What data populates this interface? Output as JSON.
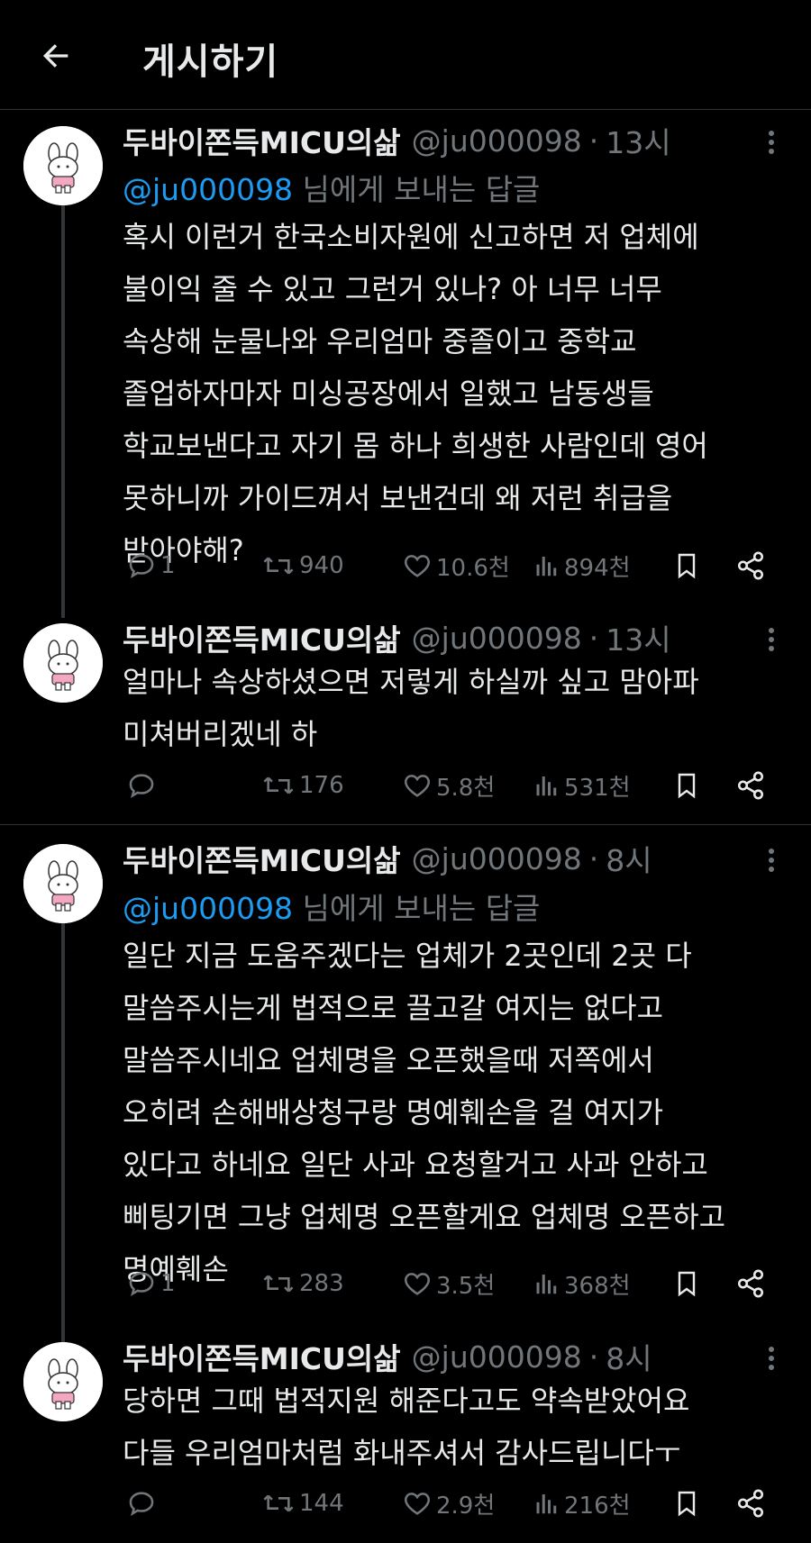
{
  "header": {
    "title": "게시하기",
    "back_icon": "arrow-left-icon"
  },
  "tweets": [
    {
      "name": "두바이쫀득MICU의삶",
      "handle": "@ju000098",
      "dot": "·",
      "time": "13시",
      "reply_mention": "@ju000098",
      "reply_suffix": " 님에게 보내는 답글",
      "text": "혹시 이런거 한국소비자원에 신고하면 저 업체에\n불이익 줄 수 있고 그런거 있나? 아 너무 너무\n속상해 눈물나와 우리엄마 중졸이고 중학교\n졸업하자마자 미싱공장에서 일했고 남동생들\n학교보낸다고 자기 몸 하나 희생한 사람인데 영어\n못하니까 가이드껴서 보낸건데 왜 저런 취급을\n받아야해?",
      "stats": {
        "replies": "1",
        "retweets": "940",
        "likes": "10.6천",
        "views": "894천"
      }
    },
    {
      "name": "두바이쫀득MICU의삶",
      "handle": "@ju000098",
      "dot": "·",
      "time": "13시",
      "text": "얼마나 속상하셨으면 저렇게 하실까 싶고 맘아파\n미쳐버리겠네 하",
      "stats": {
        "replies": "",
        "retweets": "176",
        "likes": "5.8천",
        "views": "531천"
      }
    },
    {
      "name": "두바이쫀득MICU의삶",
      "handle": "@ju000098",
      "dot": "·",
      "time": "8시",
      "reply_mention": "@ju000098",
      "reply_suffix": " 님에게 보내는 답글",
      "text": "일단 지금 도움주겠다는 업체가 2곳인데 2곳 다\n말씀주시는게 법적으로 끌고갈 여지는 없다고\n말씀주시네요 업체명을 오픈했을때 저쪽에서\n오히려 손해배상청구랑 명예훼손을 걸 여지가\n있다고 하네요 일단 사과 요청할거고 사과 안하고\n삐팅기면 그냥 업체명 오픈할게요 업체명 오픈하고\n명예훼손",
      "stats": {
        "replies": "1",
        "retweets": "283",
        "likes": "3.5천",
        "views": "368천"
      }
    },
    {
      "name": "두바이쫀득MICU의삶",
      "handle": "@ju000098",
      "dot": "·",
      "time": "8시",
      "text": "당하면 그때 법적지원 해준다고도 약속받았어요\n다들 우리엄마처럼 화내주셔서 감사드립니다ㅜ",
      "stats": {
        "replies": "",
        "retweets": "144",
        "likes": "2.9천",
        "views": "216천"
      }
    }
  ],
  "icons": {
    "reply": "reply-icon",
    "retweet": "retweet-icon",
    "like": "heart-icon",
    "views": "views-icon",
    "bookmark": "bookmark-icon",
    "share": "share-icon",
    "more": "more-vertical-icon"
  },
  "colors": {
    "background": "#000000",
    "text": "#e7e9ea",
    "muted": "#71767b",
    "link": "#1d9bf0",
    "border": "#2f3336"
  }
}
